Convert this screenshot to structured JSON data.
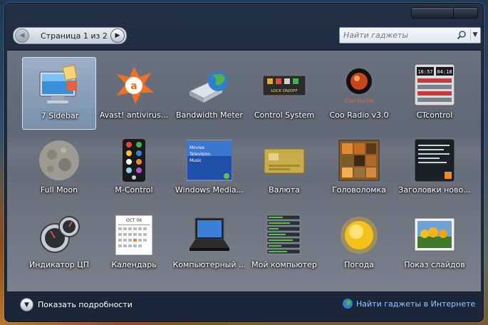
{
  "pager": {
    "text": "Страница 1 из 2",
    "prev_icon": "chevron-left-icon",
    "next_icon": "chevron-right-icon"
  },
  "search": {
    "placeholder": "Найти гаджеты",
    "value": ""
  },
  "gadgets": [
    {
      "label": "7 Sidebar",
      "icon": "monitor-icon",
      "selected": true
    },
    {
      "label": "Avast! antivirus...",
      "icon": "avast-icon"
    },
    {
      "label": "Bandwidth Meter",
      "icon": "network-globe-icon"
    },
    {
      "label": "Control System",
      "icon": "control-panel-icon"
    },
    {
      "label": "Coo Radio v3.0",
      "icon": "radio-icon"
    },
    {
      "label": "CTcontrol",
      "icon": "clock-widget-icon"
    },
    {
      "label": "Full Moon",
      "icon": "moon-icon"
    },
    {
      "label": "M-Control",
      "icon": "remote-control-icon"
    },
    {
      "label": "Windows Media...",
      "icon": "media-center-icon"
    },
    {
      "label": "Валюта",
      "icon": "currency-card-icon"
    },
    {
      "label": "Головоломка",
      "icon": "puzzle-icon"
    },
    {
      "label": "Заголовки ново...",
      "icon": "news-feed-icon"
    },
    {
      "label": "Индикатор ЦП",
      "icon": "cpu-meter-icon"
    },
    {
      "label": "Календарь",
      "icon": "calendar-icon"
    },
    {
      "label": "Компьютерный ...",
      "icon": "laptop-icon"
    },
    {
      "label": "Мой компьютер",
      "icon": "drives-icon"
    },
    {
      "label": "Погода",
      "icon": "sun-icon"
    },
    {
      "label": "Показ слайдов",
      "icon": "slideshow-icon"
    }
  ],
  "icon_text": {
    "control_system": "LOCK ON/OFF",
    "coo_radio": "Coo Radio",
    "calendar_month": "OCT 06",
    "wmc": [
      "Movies",
      "Television",
      "Music"
    ],
    "clock1": "16:57",
    "clock2": "04:18"
  },
  "footer": {
    "details_label": "Показать подробности",
    "online_label": "Найти гаджеты в Интернете"
  },
  "colors": {
    "link": "#8fc8ff",
    "selection": "#a8c8ee",
    "panel": "#666d79"
  }
}
